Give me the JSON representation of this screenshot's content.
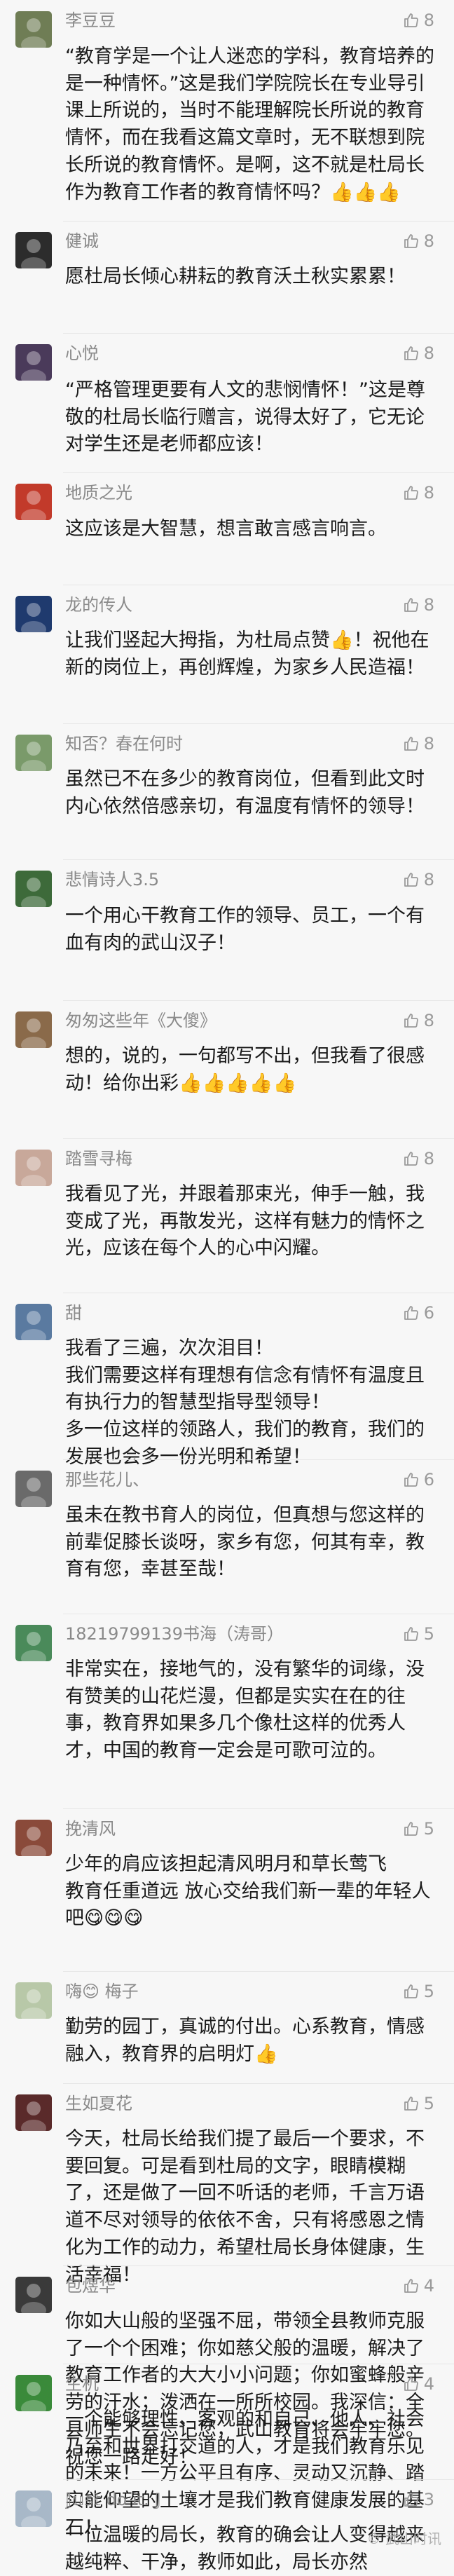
{
  "comments": [
    {
      "name": "李豆豆",
      "likes": "8",
      "text": "“教育学是一个让人迷恋的学科，教育培养的是一种情怀。”这是我们学院院长在专业导引课上所说的，当时不能理解院长所说的教育情怀，而在我看这篇文章时，无不联想到院长所说的教育情怀。是啊，这不就是杜局长作为教育工作者的教育情怀吗？👍👍👍",
      "avatar_color": "#6f7d55"
    },
    {
      "name": "健诚",
      "likes": "8",
      "text": "愿杜局长倾心耕耘的教育沃土秋实累累！",
      "avatar_color": "#2c2c2c"
    },
    {
      "name": "心悦",
      "likes": "8",
      "text": "“严格管理更要有人文的悲悯情怀！”这是尊敬的杜局长临行赠言，说得太好了，它无论对学生还是老师都应该！",
      "avatar_color": "#4a3a5a"
    },
    {
      "name": "地质之光",
      "likes": "8",
      "text": "这应该是大智慧，想言敢言感言响言。",
      "avatar_color": "#c23a2a"
    },
    {
      "name": "龙的传人",
      "likes": "8",
      "text": "让我们竖起大拇指，为杜局点赞👍！祝他在新的岗位上，再创辉煌，为家乡人民造福！",
      "avatar_color": "#1f3a6e"
    },
    {
      "name": "知否？春在何时",
      "likes": "8",
      "text": "虽然已不在多少的教育岗位，但看到此文时内心依然倍感亲切，有温度有情怀的领导！",
      "avatar_color": "#7a9a6a"
    },
    {
      "name": "悲情诗人3.5",
      "likes": "8",
      "text": "一个用心干教育工作的领导、员工，一个有血有肉的武山汉子！",
      "avatar_color": "#3d6a3a"
    },
    {
      "name": "匆匆这些年《大傻》",
      "likes": "8",
      "text": "想的，说的，一句都写不出，但我看了很感动！给你出彩👍👍👍👍👍",
      "avatar_color": "#8a6a4a"
    },
    {
      "name": "踏雪寻梅",
      "likes": "8",
      "text": "我看见了光，并跟着那束光，伸手一触，我变成了光，再散发光，这样有魅力的情怀之光，应该在每个人的心中闪耀。",
      "avatar_color": "#c8a89a"
    },
    {
      "name": "甜",
      "likes": "6",
      "text": "我看了三遍，次次泪目！\n我们需要这样有理想有信念有情怀有温度且有执行力的智慧型指导型领导！\n多一位这样的领路人，我们的教育，我们的发展也会多一份光明和希望！",
      "avatar_color": "#5a7aa0"
    },
    {
      "name": "那些花儿、",
      "likes": "6",
      "text": "虽未在教书育人的岗位，但真想与您这样的前辈促膝长谈呀，家乡有您，何其有幸，教育有您，幸甚至哉！",
      "avatar_color": "#6a6a6a"
    },
    {
      "name": "18219799139书海（涛哥）",
      "likes": "5",
      "text": "非常实在，接地气的，没有繁华的词缘，没有赞美的山花烂漫，但都是实实在在的往事，教育界如果多几个像杜这样的优秀人才，中国的教育一定会是可歌可泣的。",
      "avatar_color": "#4a8a5a"
    },
    {
      "name": "挽清风",
      "likes": "5",
      "text": "少年的肩应该担起清风明月和草长莺飞\n教育任重道远 放心交给我们新一辈的年轻人吧😋😋😋",
      "avatar_color": "#8a4a3a"
    },
    {
      "name": "嗨😊 梅子",
      "likes": "5",
      "text": "勤劳的园丁，真诚的付出。心系教育，情感融入，教育界的启明灯👍",
      "avatar_color": "#b8c8a8"
    },
    {
      "name": "生如夏花",
      "likes": "5",
      "text": "今天，杜局长给我们提了最后一个要求，不要回复。可是看到杜局的文字，眼睛模糊了，还是做了一回不听话的老师，千言万语道不尽对领导的依依不舍，只有将感恩之情化为工作的动力，希望杜局长身体健康，生活幸福！",
      "avatar_color": "#5a2a2a"
    },
    {
      "name": "包煜华",
      "likes": "4",
      "text": "你如大山般的坚强不屈，带领全县教师克服了一个个困难；你如慈父般的温暖，解决了教育工作者的大大小小问题；你如蜜蜂般辛劳的汗水；泼洒在一所所校园。我深信：全县师生不会忘记您，武山教育将会牢牢您。祝您一路走好！",
      "avatar_color": "#3a3a3a"
    },
    {
      "name": "生机",
      "likes": "4",
      "text": "一个能够理性、客观的和自己、他人、社会乃至和世界打交道的人，才是我们教育乐见的未来！一方公平且有序、灵动又沉静、踏实能仰望的土壤才是我们教育健康发展的基石！",
      "avatar_color": "#3a8a3a"
    },
    {
      "name": "𝕁𝕦𝕤𝕥 do it. 𝕁",
      "likes": "3",
      "text": "一位温暖的局长，教育的确会让人变得越来越纯粹、干净，教师如此，局长亦然",
      "avatar_color": "#a8b8c8"
    }
  ],
  "watermark": "© 武山时讯"
}
